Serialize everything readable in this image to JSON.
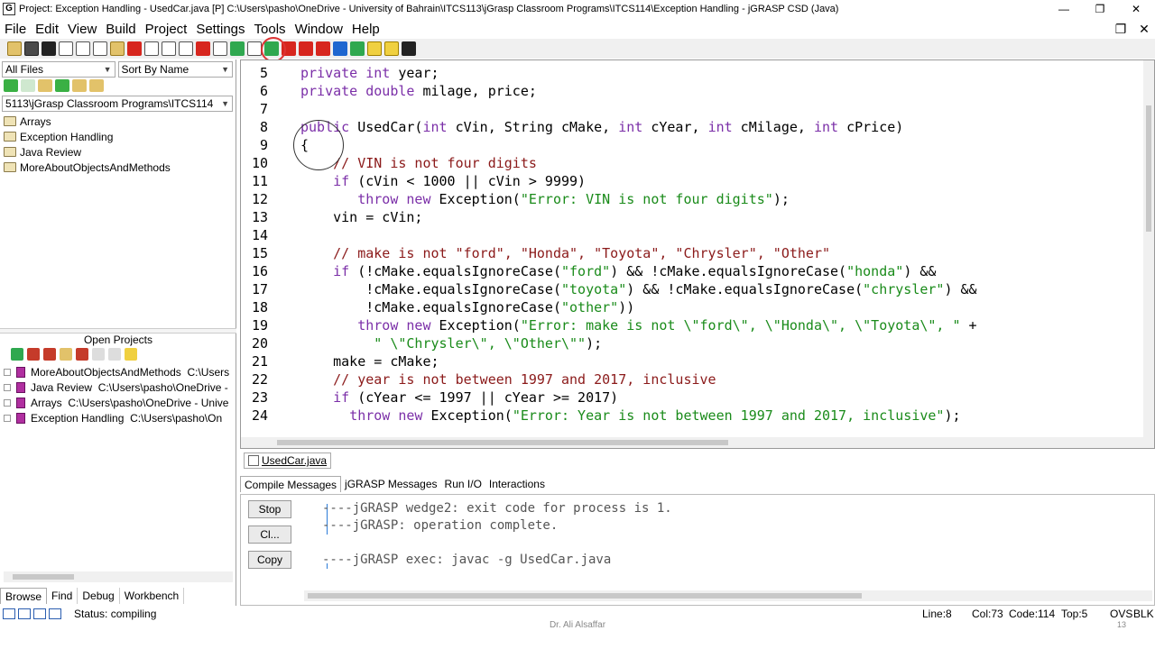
{
  "window": {
    "title": "Project: Exception Handling  -  UsedCar.java [P]  C:\\Users\\pasho\\OneDrive - University of Bahrain\\ITCS113\\jGrasp Classroom Programs\\ITCS114\\Exception Handling - jGRASP CSD (Java)",
    "app_icon": "G",
    "minimize": "—",
    "maximize": "❐",
    "close": "✕"
  },
  "menu": {
    "items": [
      "File",
      "Edit",
      "View",
      "Build",
      "Project",
      "Settings",
      "Tools",
      "Window",
      "Help"
    ],
    "mdi_restore": "❐",
    "mdi_close": "✕"
  },
  "browse": {
    "filter": "All Files",
    "sort": "Sort By Name",
    "path": "5113\\jGrasp Classroom Programs\\ITCS114",
    "folders": [
      "Arrays",
      "Exception Handling",
      "Java Review",
      "MoreAboutObjectsAndMethods"
    ]
  },
  "open_projects": {
    "title": "Open Projects",
    "items": [
      {
        "name": "MoreAboutObjectsAndMethods",
        "path": "C:\\Users"
      },
      {
        "name": "Java Review",
        "path": "C:\\Users\\pasho\\OneDrive -"
      },
      {
        "name": "Arrays",
        "path": "C:\\Users\\pasho\\OneDrive - Unive"
      },
      {
        "name": "Exception Handling",
        "path": "C:\\Users\\pasho\\On"
      }
    ]
  },
  "left_tabs": [
    "Browse",
    "Find",
    "Debug",
    "Workbench"
  ],
  "editor": {
    "line_numbers": [
      "5",
      "6",
      "7",
      "8",
      "9",
      "10",
      "11",
      "12",
      "13",
      "14",
      "15",
      "16",
      "17",
      "18",
      "19",
      "20",
      "21",
      "22",
      "23",
      "24"
    ],
    "lines": [
      [
        {
          "t": "kw",
          "v": "private"
        },
        {
          "t": "p",
          "v": " "
        },
        {
          "t": "kw",
          "v": "int"
        },
        {
          "t": "p",
          "v": " year;"
        }
      ],
      [
        {
          "t": "kw",
          "v": "private"
        },
        {
          "t": "p",
          "v": " "
        },
        {
          "t": "kw",
          "v": "double"
        },
        {
          "t": "p",
          "v": " milage, price;"
        }
      ],
      [],
      [
        {
          "t": "kw",
          "v": "public"
        },
        {
          "t": "p",
          "v": " UsedCar("
        },
        {
          "t": "kw",
          "v": "int"
        },
        {
          "t": "p",
          "v": " cVin, String cMake, "
        },
        {
          "t": "kw",
          "v": "int"
        },
        {
          "t": "p",
          "v": " cYear, "
        },
        {
          "t": "kw",
          "v": "int"
        },
        {
          "t": "p",
          "v": " cMilage, "
        },
        {
          "t": "kw",
          "v": "int"
        },
        {
          "t": "p",
          "v": " cPrice)"
        }
      ],
      [
        {
          "t": "p",
          "v": "{"
        }
      ],
      [
        {
          "t": "p",
          "v": "    "
        },
        {
          "t": "cm",
          "v": "// VIN is not four digits"
        }
      ],
      [
        {
          "t": "p",
          "v": "    "
        },
        {
          "t": "kw",
          "v": "if"
        },
        {
          "t": "p",
          "v": " (cVin < 1000 || cVin > 9999)"
        }
      ],
      [
        {
          "t": "p",
          "v": "       "
        },
        {
          "t": "kw",
          "v": "throw"
        },
        {
          "t": "p",
          "v": " "
        },
        {
          "t": "kw",
          "v": "new"
        },
        {
          "t": "p",
          "v": " Exception("
        },
        {
          "t": "str",
          "v": "\"Error: VIN is not four digits\""
        },
        {
          "t": "p",
          "v": ");"
        }
      ],
      [
        {
          "t": "p",
          "v": "    vin = cVin;"
        }
      ],
      [],
      [
        {
          "t": "p",
          "v": "    "
        },
        {
          "t": "cm",
          "v": "// make is not \"ford\", \"Honda\", \"Toyota\", \"Chrysler\", \"Other\""
        }
      ],
      [
        {
          "t": "p",
          "v": "    "
        },
        {
          "t": "kw",
          "v": "if"
        },
        {
          "t": "p",
          "v": " (!cMake.equalsIgnoreCase("
        },
        {
          "t": "str",
          "v": "\"ford\""
        },
        {
          "t": "p",
          "v": ") && !cMake.equalsIgnoreCase("
        },
        {
          "t": "str",
          "v": "\"honda\""
        },
        {
          "t": "p",
          "v": ") &&"
        }
      ],
      [
        {
          "t": "p",
          "v": "        !cMake.equalsIgnoreCase("
        },
        {
          "t": "str",
          "v": "\"toyota\""
        },
        {
          "t": "p",
          "v": ") && !cMake.equalsIgnoreCase("
        },
        {
          "t": "str",
          "v": "\"chrysler\""
        },
        {
          "t": "p",
          "v": ") &&"
        }
      ],
      [
        {
          "t": "p",
          "v": "        !cMake.equalsIgnoreCase("
        },
        {
          "t": "str",
          "v": "\"other\""
        },
        {
          "t": "p",
          "v": "))"
        }
      ],
      [
        {
          "t": "p",
          "v": "       "
        },
        {
          "t": "kw",
          "v": "throw"
        },
        {
          "t": "p",
          "v": " "
        },
        {
          "t": "kw",
          "v": "new"
        },
        {
          "t": "p",
          "v": " Exception("
        },
        {
          "t": "str",
          "v": "\"Error: make is not \\\"ford\\\", \\\"Honda\\\", \\\"Toyota\\\", \""
        },
        {
          "t": "p",
          "v": " +"
        }
      ],
      [
        {
          "t": "p",
          "v": "         "
        },
        {
          "t": "str",
          "v": "\" \\\"Chrysler\\\", \\\"Other\\\"\""
        },
        {
          "t": "p",
          "v": ");"
        }
      ],
      [
        {
          "t": "p",
          "v": "    make = cMake;"
        }
      ],
      [
        {
          "t": "p",
          "v": "    "
        },
        {
          "t": "cm",
          "v": "// year is not between 1997 and 2017, inclusive"
        }
      ],
      [
        {
          "t": "p",
          "v": "    "
        },
        {
          "t": "kw",
          "v": "if"
        },
        {
          "t": "p",
          "v": " (cYear <= 1997 || cYear >= 2017)"
        }
      ],
      [
        {
          "t": "p",
          "v": "      "
        },
        {
          "t": "kw",
          "v": "throw"
        },
        {
          "t": "p",
          "v": " "
        },
        {
          "t": "kw",
          "v": "new"
        },
        {
          "t": "p",
          "v": " Exception("
        },
        {
          "t": "str",
          "v": "\"Error: Year is not between 1997 and 2017, inclusive\""
        },
        {
          "t": "p",
          "v": ");"
        }
      ]
    ]
  },
  "file_tab": "UsedCar.java",
  "message_tabs": [
    "Compile Messages",
    "jGRASP Messages",
    "Run I/O",
    "Interactions"
  ],
  "messages": {
    "buttons": [
      "Stop",
      "Cl...",
      "Copy"
    ],
    "lines": [
      "----jGRASP wedge2: exit code for process is 1.",
      "----jGRASP: operation complete.",
      "",
      "----jGRASP exec: javac -g UsedCar.java"
    ]
  },
  "status": {
    "text": "Status: compiling",
    "line": "Line:8",
    "col": "Col:73",
    "code": "Code:114",
    "top": "Top:5",
    "ovs": "OVS",
    "blk": "BLK"
  },
  "footer": {
    "credit": "Dr. Ali Alsaffar",
    "page": "13"
  }
}
